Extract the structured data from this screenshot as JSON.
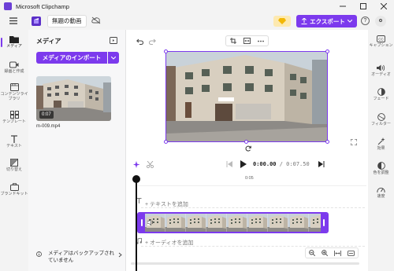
{
  "window": {
    "title": "Microsoft Clipchamp"
  },
  "header": {
    "project_name": "無題の動画",
    "export_label": "エクスポート",
    "help_label": "?",
    "avatar_initial": "o"
  },
  "left_nav": {
    "items": [
      {
        "label": "メディア",
        "icon": "folder-icon",
        "active": true
      },
      {
        "label": "録画と作成",
        "icon": "camera-icon"
      },
      {
        "label": "コンテンツライブラリ",
        "icon": "library-icon"
      },
      {
        "label": "テンプレート",
        "icon": "template-icon"
      },
      {
        "label": "テキスト",
        "icon": "text-icon"
      },
      {
        "label": "切り替え",
        "icon": "transition-icon"
      },
      {
        "label": "ブランドキット",
        "icon": "brand-kit-icon"
      }
    ]
  },
  "media_panel": {
    "title": "メディア",
    "import_label": "メディアのインポート",
    "items": [
      {
        "filename": "m-009.mp4",
        "duration": "0:07"
      }
    ],
    "backup_note": "メディアはバックアップされていません"
  },
  "playback": {
    "current_time": "0:00.00",
    "separator": " / ",
    "total_time": "0:07.50"
  },
  "timeline": {
    "ruler_label": "0:05",
    "text_track_placeholder": "+ テキストを追加",
    "audio_track_placeholder": "+ オーディオを追加"
  },
  "right_panel": {
    "items": [
      {
        "label": "キャプション",
        "icon": "captions-icon"
      },
      {
        "label": "オーディオ",
        "icon": "speaker-icon"
      },
      {
        "label": "フェード",
        "icon": "fade-icon"
      },
      {
        "label": "フィルター",
        "icon": "filter-icon"
      },
      {
        "label": "効果",
        "icon": "effects-icon"
      },
      {
        "label": "色を調整",
        "icon": "color-adjust-icon"
      },
      {
        "label": "速度",
        "icon": "speed-icon"
      }
    ]
  },
  "colors": {
    "accent": "#7c3aed",
    "panel_bg": "#f3f3f3",
    "premium": "#fde9b0"
  }
}
